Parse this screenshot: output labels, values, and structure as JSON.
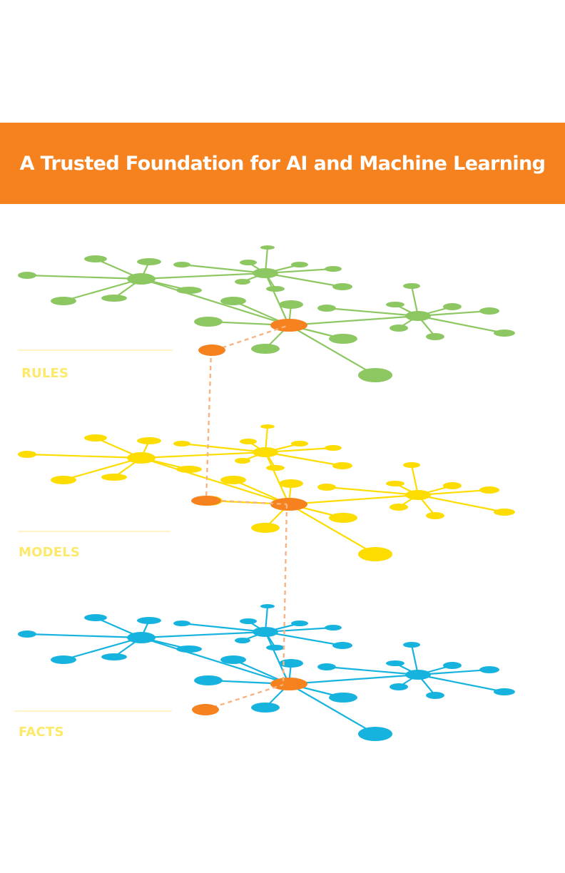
{
  "header": {
    "title": "A Trusted Foundation for AI and Machine Learning"
  },
  "layers": [
    {
      "label": "RULES",
      "color": "#8dc762"
    },
    {
      "label": "MODELS",
      "color": "#fddc00"
    },
    {
      "label": "FACTS",
      "color": "#17b3df"
    }
  ],
  "colors": {
    "banner": "#f5821f",
    "highlight_node": "#f5821f",
    "connector": "#f8b382",
    "label_text": "#fce96a"
  }
}
